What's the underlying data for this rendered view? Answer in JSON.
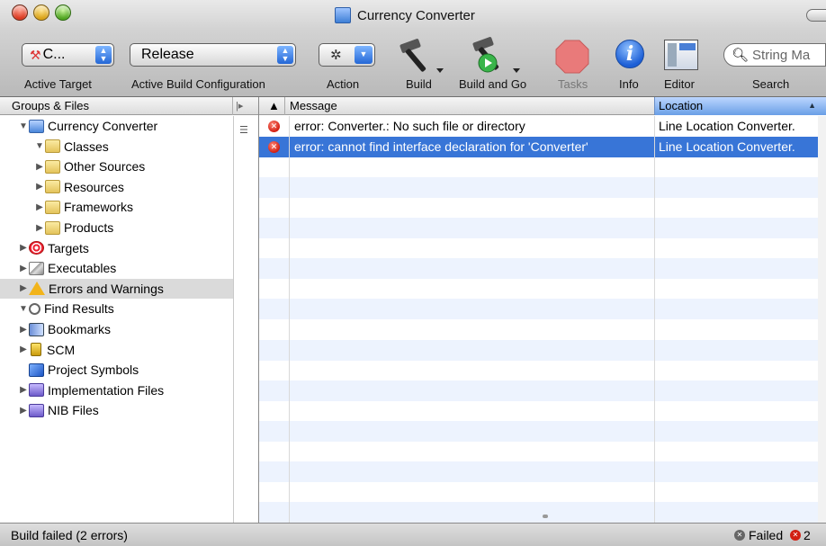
{
  "window": {
    "title": "Currency Converter"
  },
  "toolbar": {
    "active_target": {
      "value": "C...",
      "label": "Active Target"
    },
    "build_config": {
      "value": "Release",
      "label": "Active Build Configuration"
    },
    "action": {
      "label": "Action"
    },
    "build": {
      "label": "Build"
    },
    "build_and_go": {
      "label": "Build and Go"
    },
    "tasks": {
      "label": "Tasks"
    },
    "info": {
      "label": "Info",
      "glyph": "i"
    },
    "editor": {
      "label": "Editor"
    },
    "search": {
      "placeholder": "String Ma",
      "label": "Search"
    }
  },
  "sidebar": {
    "header": "Groups & Files",
    "items": [
      {
        "label": "Currency Converter",
        "icon": "project-icon",
        "level": 0,
        "expanded": true
      },
      {
        "label": "Classes",
        "icon": "folder-icon",
        "level": 1,
        "expanded": true
      },
      {
        "label": "Other Sources",
        "icon": "folder-icon",
        "level": 1,
        "expanded": false
      },
      {
        "label": "Resources",
        "icon": "folder-icon",
        "level": 1,
        "expanded": false
      },
      {
        "label": "Frameworks",
        "icon": "folder-icon",
        "level": 1,
        "expanded": false
      },
      {
        "label": "Products",
        "icon": "folder-icon",
        "level": 1,
        "expanded": false
      },
      {
        "label": "Targets",
        "icon": "target-icon",
        "level": 0,
        "expanded": false
      },
      {
        "label": "Executables",
        "icon": "executable-icon",
        "level": 0,
        "expanded": false
      },
      {
        "label": "Errors and Warnings",
        "icon": "warning-icon",
        "level": 0,
        "expanded": false,
        "selected": true
      },
      {
        "label": "Find Results",
        "icon": "magnifier-icon",
        "level": 0,
        "expanded": true
      },
      {
        "label": "Bookmarks",
        "icon": "bookmark-icon",
        "level": 0,
        "expanded": false
      },
      {
        "label": "SCM",
        "icon": "scm-icon",
        "level": 0,
        "expanded": false
      },
      {
        "label": "Project Symbols",
        "icon": "symbols-icon",
        "level": 0,
        "expanded": null
      },
      {
        "label": "Implementation Files",
        "icon": "smart-group-icon",
        "level": 0,
        "expanded": false
      },
      {
        "label": "NIB Files",
        "icon": "smart-group-icon",
        "level": 0,
        "expanded": false
      }
    ]
  },
  "table": {
    "columns": {
      "icon": "▲",
      "message": "Message",
      "location": "Location"
    },
    "rows": [
      {
        "message": "error: Converter.: No such file or directory",
        "location": "Line Location Converter.",
        "selected": false
      },
      {
        "message": "error: cannot find interface declaration for 'Converter'",
        "location": "Line Location Converter.",
        "selected": true
      }
    ]
  },
  "status": {
    "text": "Build failed (2 errors)",
    "failed_label": "Failed",
    "error_count": "2"
  },
  "colors": {
    "selection": "#3875d7",
    "error": "#d21f12"
  }
}
